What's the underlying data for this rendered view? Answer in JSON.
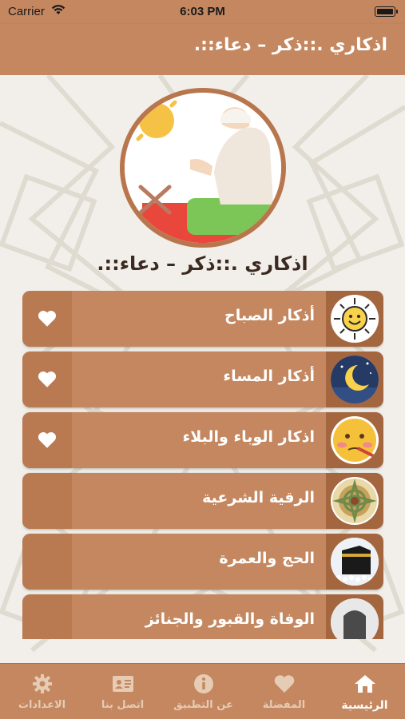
{
  "status_bar": {
    "carrier": "Carrier",
    "time": "6:03 PM"
  },
  "nav": {
    "title": "اذكاري .::ذكر – دعاء::."
  },
  "hero": {
    "title": "اذكاري .::ذكر – دعاء::."
  },
  "list": [
    {
      "label": "أذكار الصباح",
      "icon": "sun-icon",
      "favorite": true
    },
    {
      "label": "أذكار المساء",
      "icon": "moon-icon",
      "favorite": true
    },
    {
      "label": "اذكار الوباء والبلاء",
      "icon": "sick-face-icon",
      "favorite": true
    },
    {
      "label": "الرقية الشرعية",
      "icon": "ornament-icon",
      "favorite": false
    },
    {
      "label": "الحج والعمرة",
      "icon": "kaaba-icon",
      "favorite": false
    },
    {
      "label": "الوفاة والقبور والجنائز",
      "icon": "grave-icon",
      "favorite": false
    }
  ],
  "tabs": [
    {
      "label": "الرئيسية",
      "icon": "home-icon",
      "active": true
    },
    {
      "label": "المفضلة",
      "icon": "heart-icon",
      "active": false
    },
    {
      "label": "عن التطبيق",
      "icon": "info-icon",
      "active": false
    },
    {
      "label": "اتصل بنا",
      "icon": "contact-card-icon",
      "active": false
    },
    {
      "label": "الاعدادات",
      "icon": "gear-icon",
      "active": false
    }
  ],
  "colors": {
    "primary": "#c4875f",
    "heart_zone": "#b97a52",
    "icon_zone": "#a4663f",
    "background": "#f2efea"
  }
}
